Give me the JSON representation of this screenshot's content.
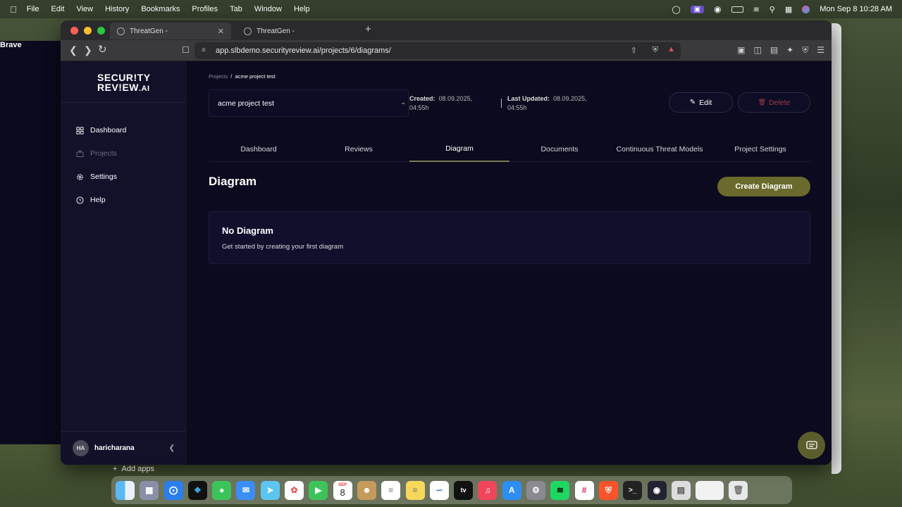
{
  "menubar": {
    "app": "Brave",
    "items": [
      "File",
      "Edit",
      "View",
      "History",
      "Bookmarks",
      "Profiles",
      "Tab",
      "Window",
      "Help"
    ],
    "clock": "Mon Sep 8  10:28 AM"
  },
  "browser": {
    "tabs": [
      {
        "title": "ThreatGen -"
      },
      {
        "title": "ThreatGen -"
      }
    ],
    "url": "app.slbdemo.securityreview.ai/projects/6/diagrams/"
  },
  "sidebar": {
    "logo_line1": "SECUR!TY",
    "logo_line2": "REV!EW",
    "logo_suffix": ".AI",
    "items": [
      {
        "label": "Dashboard",
        "icon": "grid-icon"
      },
      {
        "label": "Projects",
        "icon": "briefcase-icon"
      },
      {
        "label": "Settings",
        "icon": "gear-icon"
      },
      {
        "label": "Help",
        "icon": "help-icon"
      }
    ],
    "user": {
      "initials": "HA",
      "name": "haricharana"
    }
  },
  "main": {
    "breadcrumb": {
      "root": "Projects",
      "sep": "/",
      "current": "acme project test"
    },
    "project_select": "acme project test",
    "created_label": "Created:",
    "created_value": "08.09.2025,",
    "created_time": "04:55h",
    "updated_label": "Last Updated:",
    "updated_value": "08.09.2025,",
    "updated_time": "04:55h",
    "edit_label": "Edit",
    "delete_label": "Delete",
    "tabs": [
      "Dashboard",
      "Reviews",
      "Diagram",
      "Documents",
      "Continuous Threat Models",
      "Project Settings"
    ],
    "active_tab": "Diagram",
    "heading": "Diagram",
    "create_label": "Create Diagram",
    "empty_title": "No Diagram",
    "empty_subtitle": "Get started by creating your first diagram"
  },
  "desktop": {
    "add_apps": "Add apps",
    "calendar_day": "8",
    "calendar_month": "SEP"
  },
  "colors": {
    "accent": "#6a6a2c",
    "danger": "#a33a48",
    "bg": "#0b0a1e",
    "sidebar": "#12112a"
  }
}
